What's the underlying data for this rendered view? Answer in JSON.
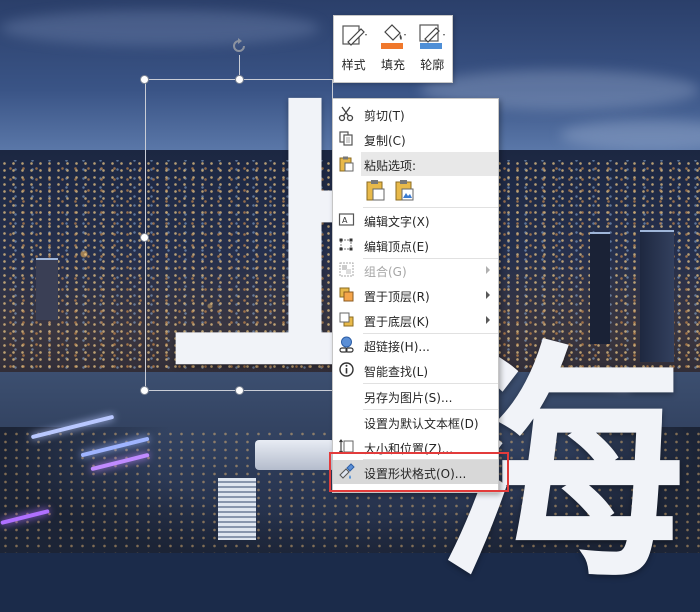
{
  "mini_toolbar": {
    "tools": [
      {
        "label": "样式",
        "icon": "style-icon"
      },
      {
        "label": "填充",
        "icon": "fill-bucket-icon"
      },
      {
        "label": "轮廓",
        "icon": "outline-pen-icon"
      }
    ]
  },
  "slide": {
    "glyph_top": "上",
    "glyph_bottom": "海"
  },
  "context_menu": {
    "items": {
      "cut": "剪切(T)",
      "copy": "复制(C)",
      "paste_options": "粘贴选项:",
      "edit_text": "编辑文字(X)",
      "edit_points": "编辑顶点(E)",
      "group": "组合(G)",
      "bring_to_front": "置于顶层(R)",
      "send_to_back": "置于底层(K)",
      "hyperlink": "超链接(H)...",
      "smart_lookup": "智能查找(L)",
      "save_as_picture": "另存为图片(S)...",
      "set_default_textbox": "设置为默认文本框(D)",
      "size_and_position": "大小和位置(Z)...",
      "format_shape": "设置形状格式(O)..."
    }
  },
  "colors": {
    "fill_accent": "#f0782c",
    "outline_accent": "#4f8fd6",
    "highlight_box": "#e23b3b"
  }
}
